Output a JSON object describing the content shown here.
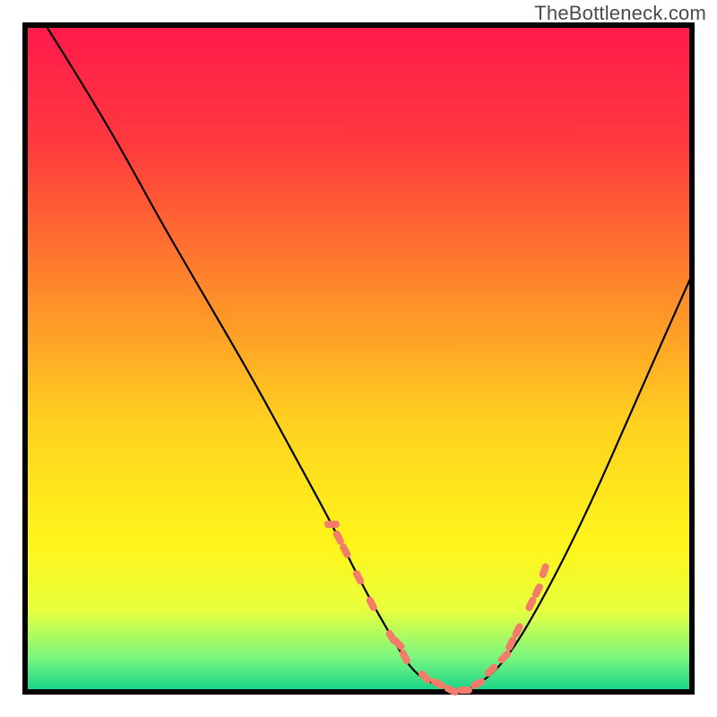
{
  "watermark": "TheBottleneck.com",
  "chart_data": {
    "type": "line",
    "title": "",
    "xlabel": "",
    "ylabel": "",
    "xlim": [
      0,
      100
    ],
    "ylim": [
      0,
      100
    ],
    "grid": false,
    "background_gradient": {
      "stops": [
        {
          "offset": 0.0,
          "color": "#ff1a4b"
        },
        {
          "offset": 0.18,
          "color": "#ff3a3d"
        },
        {
          "offset": 0.4,
          "color": "#ff8a2a"
        },
        {
          "offset": 0.6,
          "color": "#ffd21f"
        },
        {
          "offset": 0.78,
          "color": "#fff51a"
        },
        {
          "offset": 0.88,
          "color": "#e7ff3d"
        },
        {
          "offset": 0.95,
          "color": "#7cf77f"
        },
        {
          "offset": 1.0,
          "color": "#17d488"
        }
      ]
    },
    "series": [
      {
        "name": "bottleneck-curve",
        "type": "line",
        "color": "#000000",
        "x": [
          3,
          8,
          14,
          20,
          27,
          34,
          40,
          46,
          51,
          55,
          58,
          61,
          64,
          67,
          72,
          78,
          85,
          92,
          100
        ],
        "values": [
          100,
          92,
          82,
          71,
          59,
          47,
          36,
          25,
          15,
          8,
          3,
          1,
          0,
          0,
          4,
          14,
          28,
          44,
          62
        ]
      },
      {
        "name": "highlight-dots",
        "type": "scatter",
        "color": "#f47c6a",
        "x": [
          46,
          47,
          48,
          50,
          52,
          55,
          56,
          57,
          60,
          62,
          64,
          66,
          68,
          70,
          72,
          73,
          74,
          76,
          77,
          78
        ],
        "values": [
          25,
          23,
          21,
          17,
          13,
          8,
          7,
          5,
          2,
          1,
          0,
          0,
          1,
          3,
          5,
          7,
          9,
          13,
          15,
          18
        ]
      }
    ]
  }
}
